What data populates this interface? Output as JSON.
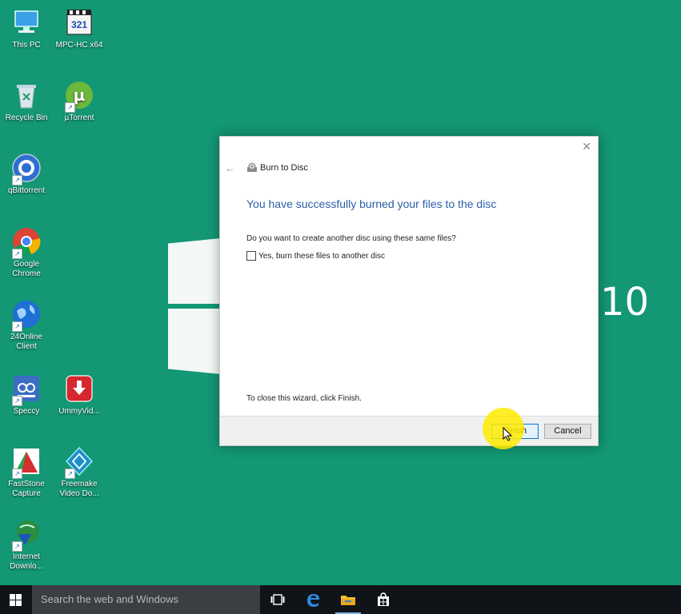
{
  "wallpaper": {
    "ten": "10"
  },
  "desktop": {
    "icons": [
      {
        "label": "This PC"
      },
      {
        "label": "MPC-HC x64",
        "badge": "321"
      },
      {
        "label": "Recycle Bin"
      },
      {
        "label": "µTorrent"
      },
      {
        "label": "qBittorrent"
      },
      {
        "label": "Google Chrome"
      },
      {
        "label": "24Online Client"
      },
      {
        "label": "Speccy"
      },
      {
        "label": "UmmyVid..."
      },
      {
        "label": "FastStone Capture"
      },
      {
        "label": "Freemake Video Do..."
      },
      {
        "label": "Internet Downlo..."
      }
    ]
  },
  "dialog": {
    "close_glyph": "✕",
    "back_glyph": "←",
    "title": "Burn to Disc",
    "heading": "You have successfully burned your files to the disc",
    "question": "Do you want to create another disc using these same files?",
    "checkbox_label": "Yes, burn these files to another disc",
    "footnote": "To close this wizard, click Finish.",
    "finish_label": "Finish",
    "cancel_label": "Cancel"
  },
  "taskbar": {
    "search_placeholder": "Search the web and Windows"
  },
  "colors": {
    "desktop": "#139774",
    "heading": "#2c5ea8",
    "taskbar": "#101418",
    "highlight": "#ffeb00"
  }
}
